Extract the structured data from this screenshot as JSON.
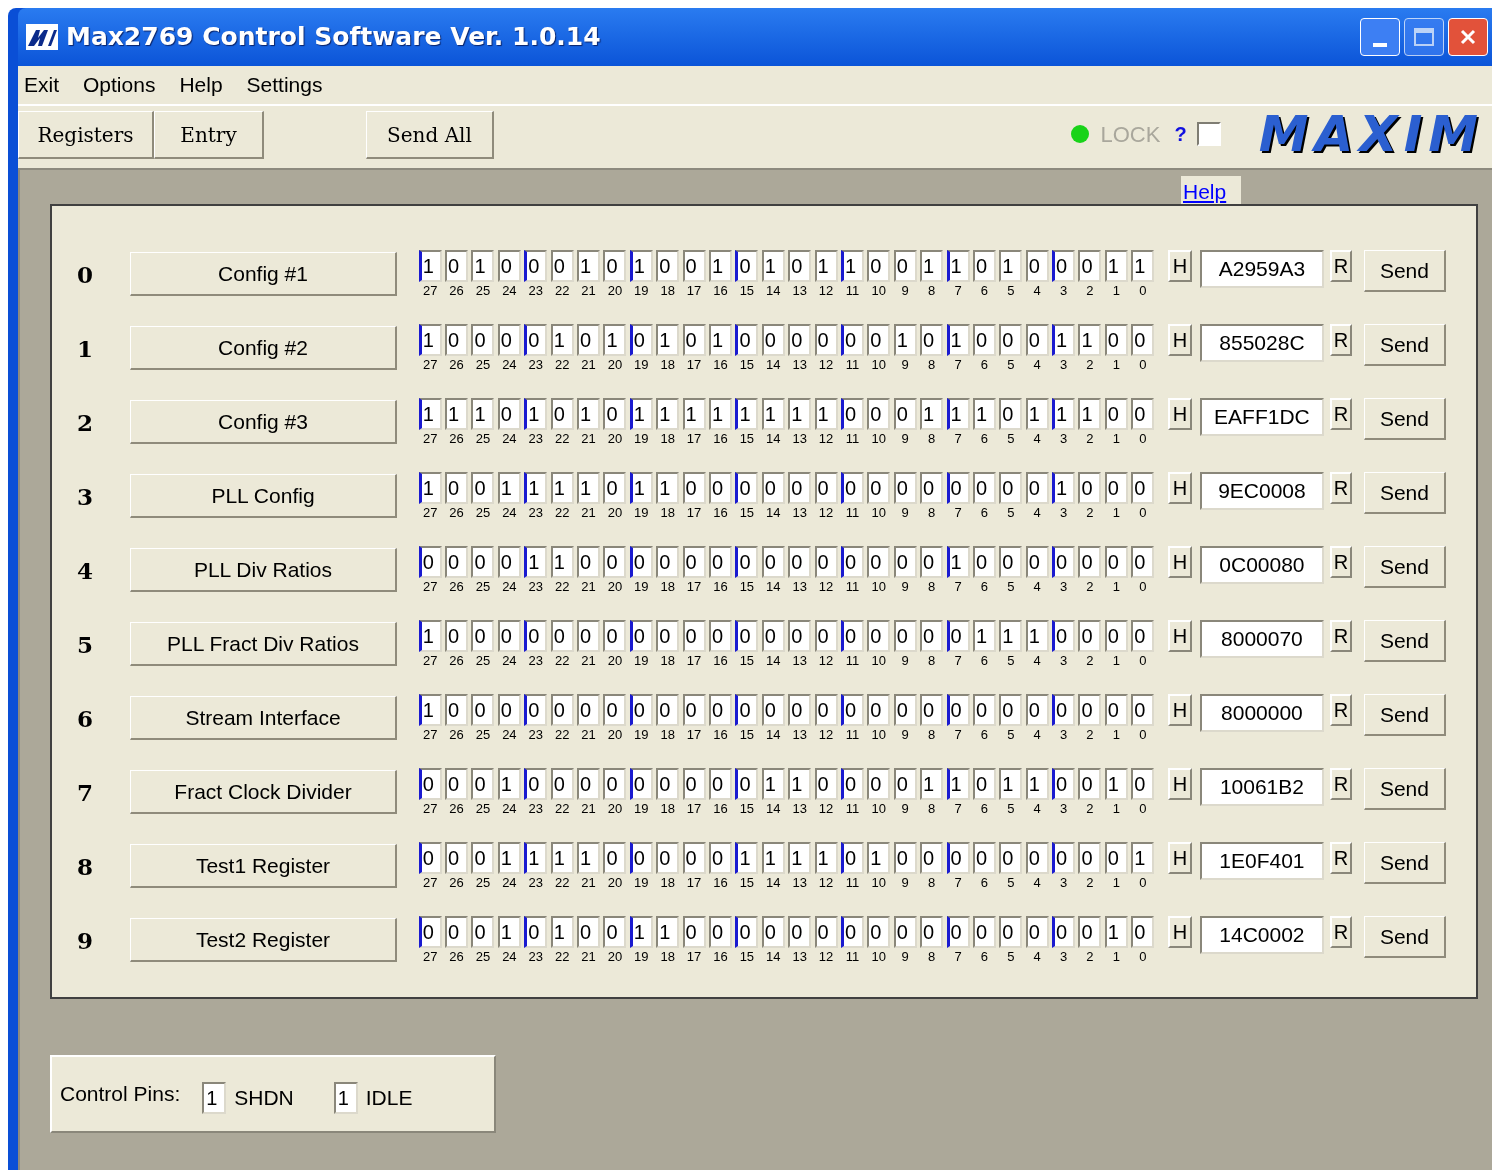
{
  "window": {
    "title": "Max2769 Control Software Ver. 1.0.14"
  },
  "menu": [
    "Exit",
    "Options",
    "Help",
    "Settings"
  ],
  "toolbar": {
    "buttons": [
      "Registers",
      "Entry",
      "Send All"
    ],
    "lock": {
      "on": true,
      "label": "LOCK",
      "help": "?",
      "checked": false
    },
    "logo": "MAXIM"
  },
  "help_tab": "Help",
  "registers": [
    {
      "index": "0",
      "name": "Config #1",
      "bits": [
        "1",
        "0",
        "1",
        "0",
        "0",
        "0",
        "1",
        "0",
        "1",
        "0",
        "0",
        "1",
        "0",
        "1",
        "0",
        "1",
        "1",
        "0",
        "0",
        "1",
        "1",
        "0",
        "1",
        "0",
        "0",
        "0",
        "1",
        "1"
      ],
      "bit_numbers": [
        "27",
        "26",
        "25",
        "24",
        "23",
        "22",
        "21",
        "20",
        "19",
        "18",
        "17",
        "16",
        "15",
        "14",
        "13",
        "12",
        "11",
        "10",
        "9",
        "8",
        "7",
        "6",
        "5",
        "4",
        "3",
        "2",
        "1",
        "0"
      ],
      "h_label": "H",
      "hex": "A2959A3",
      "r_label": "R",
      "send": "Send"
    },
    {
      "index": "1",
      "name": "Config #2",
      "bits": [
        "1",
        "0",
        "0",
        "0",
        "0",
        "1",
        "0",
        "1",
        "0",
        "1",
        "0",
        "1",
        "0",
        "0",
        "0",
        "0",
        "0",
        "0",
        "1",
        "0",
        "1",
        "0",
        "0",
        "0",
        "1",
        "1",
        "0",
        "0"
      ],
      "bit_numbers": [
        "27",
        "26",
        "25",
        "24",
        "23",
        "22",
        "21",
        "20",
        "19",
        "18",
        "17",
        "16",
        "15",
        "14",
        "13",
        "12",
        "11",
        "10",
        "9",
        "8",
        "7",
        "6",
        "5",
        "4",
        "3",
        "2",
        "1",
        "0"
      ],
      "h_label": "H",
      "hex": "855028C",
      "r_label": "R",
      "send": "Send"
    },
    {
      "index": "2",
      "name": "Config #3",
      "bits": [
        "1",
        "1",
        "1",
        "0",
        "1",
        "0",
        "1",
        "0",
        "1",
        "1",
        "1",
        "1",
        "1",
        "1",
        "1",
        "1",
        "0",
        "0",
        "0",
        "1",
        "1",
        "1",
        "0",
        "1",
        "1",
        "1",
        "0",
        "0"
      ],
      "bit_numbers": [
        "27",
        "26",
        "25",
        "24",
        "23",
        "22",
        "21",
        "20",
        "19",
        "18",
        "17",
        "16",
        "15",
        "14",
        "13",
        "12",
        "11",
        "10",
        "9",
        "8",
        "7",
        "6",
        "5",
        "4",
        "3",
        "2",
        "1",
        "0"
      ],
      "h_label": "H",
      "hex": "EAFF1DC",
      "r_label": "R",
      "send": "Send"
    },
    {
      "index": "3",
      "name": "PLL Config",
      "bits": [
        "1",
        "0",
        "0",
        "1",
        "1",
        "1",
        "1",
        "0",
        "1",
        "1",
        "0",
        "0",
        "0",
        "0",
        "0",
        "0",
        "0",
        "0",
        "0",
        "0",
        "0",
        "0",
        "0",
        "0",
        "1",
        "0",
        "0",
        "0"
      ],
      "bit_numbers": [
        "27",
        "26",
        "25",
        "24",
        "23",
        "22",
        "21",
        "20",
        "19",
        "18",
        "17",
        "16",
        "15",
        "14",
        "13",
        "12",
        "11",
        "10",
        "9",
        "8",
        "7",
        "6",
        "5",
        "4",
        "3",
        "2",
        "1",
        "0"
      ],
      "h_label": "H",
      "hex": "9EC0008",
      "r_label": "R",
      "send": "Send"
    },
    {
      "index": "4",
      "name": "PLL Div Ratios",
      "bits": [
        "0",
        "0",
        "0",
        "0",
        "1",
        "1",
        "0",
        "0",
        "0",
        "0",
        "0",
        "0",
        "0",
        "0",
        "0",
        "0",
        "0",
        "0",
        "0",
        "0",
        "1",
        "0",
        "0",
        "0",
        "0",
        "0",
        "0",
        "0"
      ],
      "bit_numbers": [
        "27",
        "26",
        "25",
        "24",
        "23",
        "22",
        "21",
        "20",
        "19",
        "18",
        "17",
        "16",
        "15",
        "14",
        "13",
        "12",
        "11",
        "10",
        "9",
        "8",
        "7",
        "6",
        "5",
        "4",
        "3",
        "2",
        "1",
        "0"
      ],
      "h_label": "H",
      "hex": "0C00080",
      "r_label": "R",
      "send": "Send"
    },
    {
      "index": "5",
      "name": "PLL Fract Div Ratios",
      "bits": [
        "1",
        "0",
        "0",
        "0",
        "0",
        "0",
        "0",
        "0",
        "0",
        "0",
        "0",
        "0",
        "0",
        "0",
        "0",
        "0",
        "0",
        "0",
        "0",
        "0",
        "0",
        "1",
        "1",
        "1",
        "0",
        "0",
        "0",
        "0"
      ],
      "bit_numbers": [
        "27",
        "26",
        "25",
        "24",
        "23",
        "22",
        "21",
        "20",
        "19",
        "18",
        "17",
        "16",
        "15",
        "14",
        "13",
        "12",
        "11",
        "10",
        "9",
        "8",
        "7",
        "6",
        "5",
        "4",
        "3",
        "2",
        "1",
        "0"
      ],
      "h_label": "H",
      "hex": "8000070",
      "r_label": "R",
      "send": "Send"
    },
    {
      "index": "6",
      "name": "Stream Interface",
      "bits": [
        "1",
        "0",
        "0",
        "0",
        "0",
        "0",
        "0",
        "0",
        "0",
        "0",
        "0",
        "0",
        "0",
        "0",
        "0",
        "0",
        "0",
        "0",
        "0",
        "0",
        "0",
        "0",
        "0",
        "0",
        "0",
        "0",
        "0",
        "0"
      ],
      "bit_numbers": [
        "27",
        "26",
        "25",
        "24",
        "23",
        "22",
        "21",
        "20",
        "19",
        "18",
        "17",
        "16",
        "15",
        "14",
        "13",
        "12",
        "11",
        "10",
        "9",
        "8",
        "7",
        "6",
        "5",
        "4",
        "3",
        "2",
        "1",
        "0"
      ],
      "h_label": "H",
      "hex": "8000000",
      "r_label": "R",
      "send": "Send"
    },
    {
      "index": "7",
      "name": "Fract Clock Divider",
      "bits": [
        "0",
        "0",
        "0",
        "1",
        "0",
        "0",
        "0",
        "0",
        "0",
        "0",
        "0",
        "0",
        "0",
        "1",
        "1",
        "0",
        "0",
        "0",
        "0",
        "1",
        "1",
        "0",
        "1",
        "1",
        "0",
        "0",
        "1",
        "0"
      ],
      "bit_numbers": [
        "27",
        "26",
        "25",
        "24",
        "23",
        "22",
        "21",
        "20",
        "19",
        "18",
        "17",
        "16",
        "15",
        "14",
        "13",
        "12",
        "11",
        "10",
        "9",
        "8",
        "7",
        "6",
        "5",
        "4",
        "3",
        "2",
        "1",
        "0"
      ],
      "h_label": "H",
      "hex": "10061B2",
      "r_label": "R",
      "send": "Send"
    },
    {
      "index": "8",
      "name": "Test1 Register",
      "bits": [
        "0",
        "0",
        "0",
        "1",
        "1",
        "1",
        "1",
        "0",
        "0",
        "0",
        "0",
        "0",
        "1",
        "1",
        "1",
        "1",
        "0",
        "1",
        "0",
        "0",
        "0",
        "0",
        "0",
        "0",
        "0",
        "0",
        "0",
        "1"
      ],
      "bit_numbers": [
        "27",
        "26",
        "25",
        "24",
        "23",
        "22",
        "21",
        "20",
        "19",
        "18",
        "17",
        "16",
        "15",
        "14",
        "13",
        "12",
        "11",
        "10",
        "9",
        "8",
        "7",
        "6",
        "5",
        "4",
        "3",
        "2",
        "1",
        "0"
      ],
      "h_label": "H",
      "hex": "1E0F401",
      "r_label": "R",
      "send": "Send"
    },
    {
      "index": "9",
      "name": "Test2 Register",
      "bits": [
        "0",
        "0",
        "0",
        "1",
        "0",
        "1",
        "0",
        "0",
        "1",
        "1",
        "0",
        "0",
        "0",
        "0",
        "0",
        "0",
        "0",
        "0",
        "0",
        "0",
        "0",
        "0",
        "0",
        "0",
        "0",
        "0",
        "1",
        "0"
      ],
      "bit_numbers": [
        "27",
        "26",
        "25",
        "24",
        "23",
        "22",
        "21",
        "20",
        "19",
        "18",
        "17",
        "16",
        "15",
        "14",
        "13",
        "12",
        "11",
        "10",
        "9",
        "8",
        "7",
        "6",
        "5",
        "4",
        "3",
        "2",
        "1",
        "0"
      ],
      "h_label": "H",
      "hex": "14C0002",
      "r_label": "R",
      "send": "Send"
    }
  ],
  "control_pins": {
    "label": "Control Pins:",
    "pins": [
      {
        "value": "1",
        "name": "SHDN"
      },
      {
        "value": "1",
        "name": "IDLE"
      }
    ]
  }
}
